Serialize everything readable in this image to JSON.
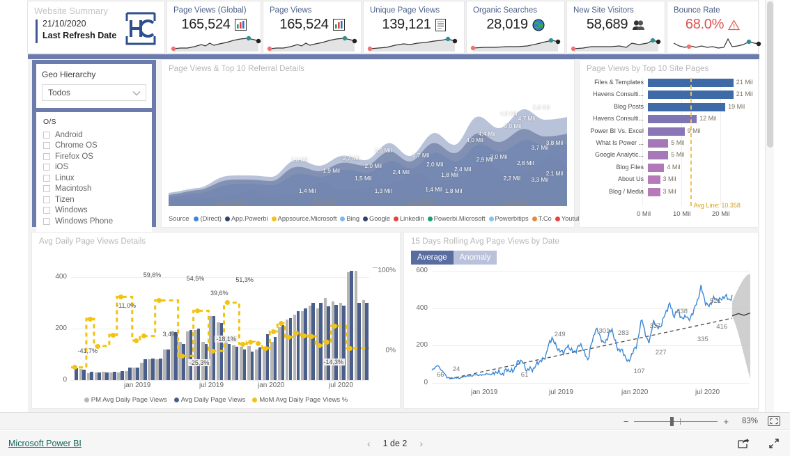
{
  "summary_card": {
    "title": "Website Summary",
    "date": "21/10/2020",
    "subtitle": "Last Refresh Date",
    "logo_icon": "hc-logo-icon"
  },
  "kpis": [
    {
      "label": "Page Views (Global)",
      "value": "165,524",
      "icon": "bar-chart-icon",
      "alert": false
    },
    {
      "label": "Page Views",
      "value": "165,524",
      "icon": "bar-chart-icon",
      "alert": false
    },
    {
      "label": "Unique Page Views",
      "value": "139,121",
      "icon": "document-icon",
      "alert": false
    },
    {
      "label": "Organic Searches",
      "value": "28,019",
      "icon": "globe-icon",
      "alert": false
    },
    {
      "label": "New Site Visitors",
      "value": "58,689",
      "icon": "people-icon",
      "alert": false
    },
    {
      "label": "Bounce Rate",
      "value": "68.0%",
      "icon": "warning-icon",
      "alert": true
    }
  ],
  "filters": {
    "geo": {
      "title": "Geo Hierarchy",
      "selected": "Todos",
      "chevron_icon": "chevron-down-icon"
    },
    "os": {
      "title": "O/S",
      "items": [
        {
          "label": "Android",
          "checked": false
        },
        {
          "label": "Chrome OS",
          "checked": false
        },
        {
          "label": "Firefox OS",
          "checked": false
        },
        {
          "label": "iOS",
          "checked": false
        },
        {
          "label": "Linux",
          "checked": false
        },
        {
          "label": "Macintosh",
          "checked": false
        },
        {
          "label": "Tizen",
          "checked": false
        },
        {
          "label": "Windows",
          "checked": false
        },
        {
          "label": "Windows Phone",
          "checked": false
        }
      ]
    }
  },
  "colors": {
    "accent_blue": "#4a5e8c",
    "panel_blue": "#6b7bab",
    "yellow": "#f2c310",
    "red": "#e05252",
    "grey_bar": "#b6b6b6",
    "line_blue": "#3b87d6",
    "purple": "#9b79b5",
    "avg_line": "#f2c14e"
  },
  "chart_data": [
    {
      "id": "page-views-referral",
      "type": "area",
      "title": "Page Views & Top 10 Referral Details",
      "xlabel": "",
      "ylabel": "",
      "grid": false,
      "legend_position": "bottom",
      "legend_title": "Source",
      "xticks": [
        "jan 2019",
        "jul 2019",
        "jan 2020",
        "jul 2020"
      ],
      "series": [
        {
          "name": "(Direct)",
          "color": "#3b87d6"
        },
        {
          "name": "App.Powerbi",
          "color": "#33406b"
        },
        {
          "name": "Appsource.Microsoft",
          "color": "#f2c310"
        },
        {
          "name": "Bing",
          "color": "#7fb8ee"
        },
        {
          "name": "Google",
          "color": "#33406b"
        },
        {
          "name": "Linkedin",
          "color": "#e8413c"
        },
        {
          "name": "Powerbi.Microsoft",
          "color": "#17a06e"
        },
        {
          "name": "Powerbitips",
          "color": "#7fc4ee"
        },
        {
          "name": "T.Co",
          "color": "#e8883c"
        },
        {
          "name": "Youtube",
          "color": "#e8413c"
        }
      ],
      "data_labels": [
        {
          "text": "2,0 Mil",
          "x": 0.335,
          "y": 0.63
        },
        {
          "text": "1,4 Mil",
          "x": 0.355,
          "y": 0.88
        },
        {
          "text": "1,9 Mil",
          "x": 0.415,
          "y": 0.72
        },
        {
          "text": "2,7 Mil",
          "x": 0.465,
          "y": 0.62
        },
        {
          "text": "1,5 Mil",
          "x": 0.495,
          "y": 0.78
        },
        {
          "text": "2,0 Mil",
          "x": 0.52,
          "y": 0.68
        },
        {
          "text": "3,6 Mil",
          "x": 0.545,
          "y": 0.56
        },
        {
          "text": "1,3 Mil",
          "x": 0.545,
          "y": 0.88
        },
        {
          "text": "2,4 Mil",
          "x": 0.59,
          "y": 0.73
        },
        {
          "text": "2,7 Mil",
          "x": 0.64,
          "y": 0.6
        },
        {
          "text": "2,0 Mil",
          "x": 0.675,
          "y": 0.67
        },
        {
          "text": "1,4 Mil",
          "x": 0.672,
          "y": 0.87
        },
        {
          "text": "1,8 Mil",
          "x": 0.712,
          "y": 0.75
        },
        {
          "text": "1,8 Mil",
          "x": 0.722,
          "y": 0.88
        },
        {
          "text": "2,4 Mil",
          "x": 0.745,
          "y": 0.71
        },
        {
          "text": "4,0 Mil",
          "x": 0.775,
          "y": 0.48
        },
        {
          "text": "4,4 Mil",
          "x": 0.805,
          "y": 0.43
        },
        {
          "text": "2,9 Mil",
          "x": 0.8,
          "y": 0.63
        },
        {
          "text": "3,0 Mil",
          "x": 0.835,
          "y": 0.61
        },
        {
          "text": "4,9 Mil",
          "x": 0.86,
          "y": 0.27
        },
        {
          "text": "5,0 Mil",
          "x": 0.87,
          "y": 0.37
        },
        {
          "text": "2,2 Mil",
          "x": 0.868,
          "y": 0.78
        },
        {
          "text": "4,7 Mil",
          "x": 0.905,
          "y": 0.31
        },
        {
          "text": "2,8 Mil",
          "x": 0.902,
          "y": 0.66
        },
        {
          "text": "5,8 Mil",
          "x": 0.942,
          "y": 0.22
        },
        {
          "text": "3,7 Mil",
          "x": 0.938,
          "y": 0.54
        },
        {
          "text": "3,3 Mil",
          "x": 0.938,
          "y": 0.79
        },
        {
          "text": "3,8 Mil",
          "x": 0.975,
          "y": 0.5
        },
        {
          "text": "2,1 Mil",
          "x": 0.975,
          "y": 0.74
        }
      ]
    },
    {
      "id": "top10-site-pages",
      "type": "bar",
      "title": "Page Views by Top 10 Site Pages",
      "orientation": "horizontal",
      "xlabel": "",
      "ylabel": "",
      "grid": true,
      "xticks": [
        "0 Mil",
        "10 Mil",
        "20 Mil"
      ],
      "xlim": [
        0,
        26
      ],
      "avg_line": {
        "value": 10.358,
        "label": "Avg Line: 10.358",
        "color": "#f2c14e"
      },
      "categories": [
        "Files & Templates",
        "Havens Consulti...",
        "Blog Posts",
        "Havens Consulti...",
        "Power BI Vs. Excel",
        "What Is Power ...",
        "Google Analytic...",
        "Blog Files",
        "About Us",
        "Blog / Media"
      ],
      "values": [
        21,
        21,
        19,
        12,
        9,
        5,
        5,
        4,
        3,
        3
      ],
      "value_labels": [
        "21 Mil",
        "21 Mil",
        "19 Mil",
        "12 Mil",
        "9 Mil",
        "5 Mil",
        "5 Mil",
        "4 Mil",
        "3 Mil",
        "3 Mil"
      ],
      "bar_colors": [
        "#3e6aa8",
        "#3e6aa8",
        "#3e6aa8",
        "#7d75b4",
        "#8a76b6",
        "#a578b8",
        "#a578b8",
        "#b078b8",
        "#b77ab8",
        "#b77ab8"
      ]
    },
    {
      "id": "avg-daily-page-views",
      "type": "bar",
      "title": "Avg Daily Page Views Details",
      "xlabel": "",
      "ylabel": "",
      "grid": true,
      "legend_position": "bottom",
      "yticks": [
        "0",
        "200",
        "400"
      ],
      "ylim": [
        0,
        460
      ],
      "y2ticks": [
        "0%",
        "100%"
      ],
      "y2lim": [
        -60,
        110
      ],
      "xticks": [
        "jan 2019",
        "jul 2019",
        "jan 2020",
        "jul 2020"
      ],
      "series": [
        {
          "name": "PM Avg Daily Page Views",
          "color": "#b6b6b6",
          "values": [
            0,
            44,
            28,
            30,
            32,
            31,
            31,
            35,
            48,
            68,
            80,
            82,
            120,
            190,
            150,
            190,
            195,
            148,
            250,
            225,
            145,
            135,
            130,
            132,
            118,
            130,
            148,
            205,
            235,
            255,
            268,
            290,
            280,
            320,
            305,
            300,
            420,
            425,
            310
          ]
        },
        {
          "name": "Avg Daily Page Views",
          "color": "#4a5e8c",
          "values": [
            45,
            40,
            32,
            30,
            31,
            32,
            35,
            48,
            50,
            80,
            83,
            85,
            120,
            188,
            140,
            195,
            200,
            140,
            248,
            222,
            140,
            130,
            118,
            110,
            128,
            178,
            168,
            215,
            240,
            268,
            278,
            300,
            300,
            288,
            292,
            290,
            425,
            300,
            300
          ]
        },
        {
          "name": "MoM Avg Daily Page Views %",
          "color": "#f2c310",
          "values": [
            -41.7,
            -41.7,
            28.0,
            -11.0,
            -11.0,
            5.0,
            59.6,
            59.6,
            -3.0,
            3.4,
            3.4,
            54.5,
            54.5,
            54.5,
            -25.3,
            -25.3,
            39.6,
            39.6,
            -18.1,
            -18.1,
            51.3,
            51.3,
            -8.0,
            -5.0,
            -7.0,
            -14.0,
            10.0,
            22.0,
            2.0,
            8.0,
            4.0,
            3.0,
            -10.0,
            -5.0,
            18.0,
            18.0,
            -14.3,
            -14.3,
            -14.3
          ]
        }
      ],
      "data_labels": [
        {
          "text": "-41,7%",
          "x": 0.055,
          "y": 0.76
        },
        {
          "text": "-11,0%",
          "x": 0.185,
          "y": 0.375
        },
        {
          "text": "59,6%",
          "x": 0.275,
          "y": 0.115
        },
        {
          "text": "3,4%",
          "x": 0.34,
          "y": 0.62
        },
        {
          "text": "54,5%",
          "x": 0.42,
          "y": 0.145
        },
        {
          "text": "-25,3%",
          "x": 0.425,
          "y": 0.86
        },
        {
          "text": "39,6%",
          "x": 0.5,
          "y": 0.27
        },
        {
          "text": "-18,1%",
          "x": 0.515,
          "y": 0.66
        },
        {
          "text": "51,3%",
          "x": 0.585,
          "y": 0.16
        },
        {
          "text": "-14,3%",
          "x": 0.875,
          "y": 0.855
        }
      ]
    },
    {
      "id": "rolling-avg-page-views",
      "type": "line",
      "title": "15 Days Rolling Avg Page Views by Date",
      "xlabel": "",
      "ylabel": "",
      "grid": true,
      "toggle": {
        "options": [
          "Average",
          "Anomaly"
        ],
        "selected": "Average"
      },
      "yticks": [
        "0",
        "200",
        "400",
        "600"
      ],
      "ylim": [
        0,
        620
      ],
      "xticks": [
        "jan 2019",
        "jul 2019",
        "jan 2020",
        "jul 2020"
      ],
      "trendline": true,
      "forecast_band": true,
      "annotations": [
        {
          "text": "66",
          "x": 0.035,
          "y": 0.935
        },
        {
          "text": "24",
          "x": 0.085,
          "y": 0.885
        },
        {
          "text": "61",
          "x": 0.3,
          "y": 0.935
        },
        {
          "text": "249",
          "x": 0.405,
          "y": 0.585
        },
        {
          "text": "301",
          "x": 0.545,
          "y": 0.555
        },
        {
          "text": "283",
          "x": 0.605,
          "y": 0.575
        },
        {
          "text": "107",
          "x": 0.655,
          "y": 0.905
        },
        {
          "text": "337",
          "x": 0.705,
          "y": 0.51
        },
        {
          "text": "227",
          "x": 0.723,
          "y": 0.74
        },
        {
          "text": "438",
          "x": 0.79,
          "y": 0.385
        },
        {
          "text": "335",
          "x": 0.855,
          "y": 0.625
        },
        {
          "text": "521",
          "x": 0.895,
          "y": 0.295
        },
        {
          "text": "416",
          "x": 0.915,
          "y": 0.52
        }
      ]
    }
  ],
  "zoombar": {
    "minus": "−",
    "plus": "+",
    "percent": "83%",
    "fit_icon": "fit-to-page-icon"
  },
  "footer": {
    "link": "Microsoft Power BI",
    "prev_icon": "chevron-left-icon",
    "page": "1 de 2",
    "next_icon": "chevron-right-icon",
    "share_icon": "share-icon",
    "fullscreen_icon": "fullscreen-icon"
  }
}
